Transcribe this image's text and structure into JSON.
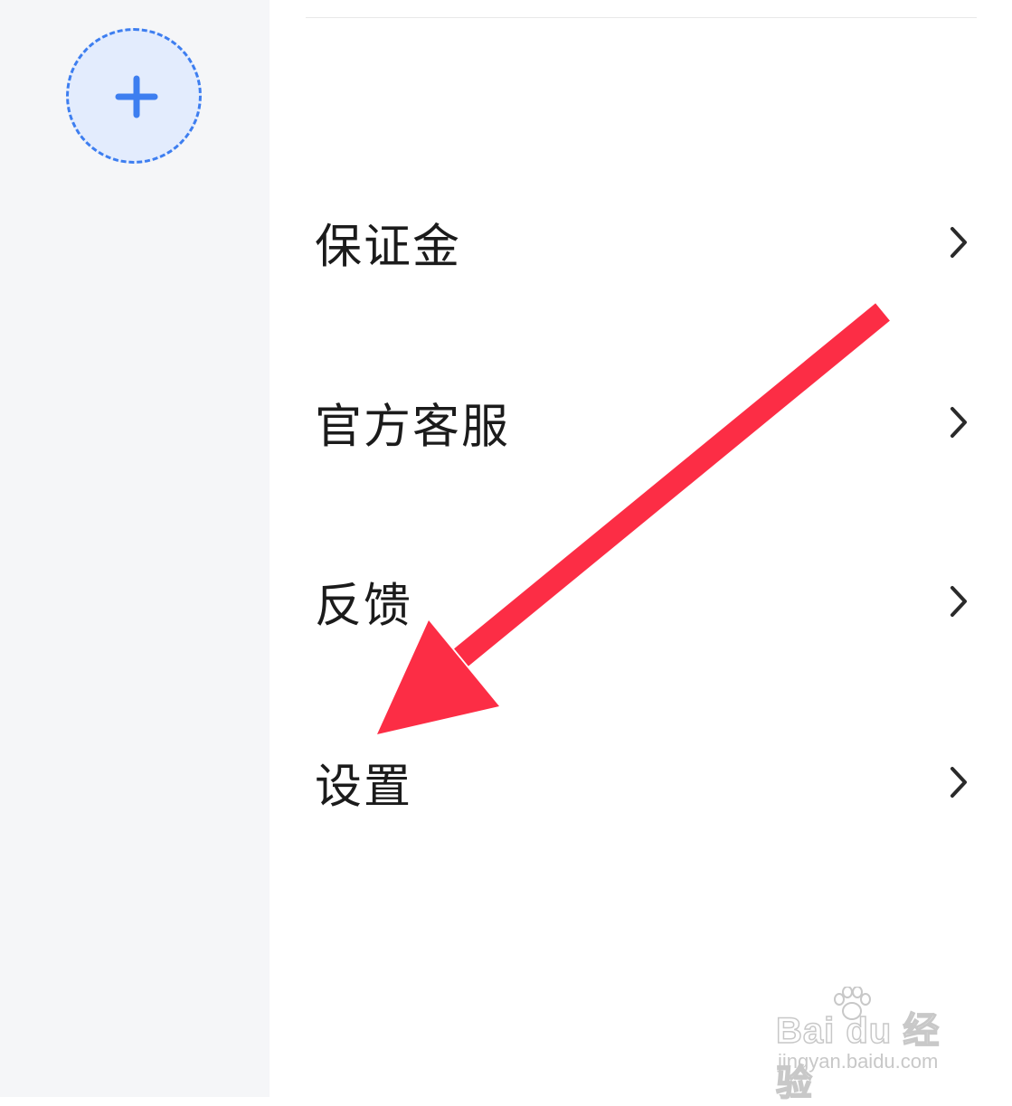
{
  "sidebar": {
    "add_button": {
      "icon": "plus-icon",
      "accent": "#3d7ef0",
      "fill": "#e3ecfd"
    }
  },
  "menu": {
    "items": [
      {
        "label": "保证金",
        "icon": "chevron-right-icon"
      },
      {
        "label": "官方客服",
        "icon": "chevron-right-icon"
      },
      {
        "label": "反馈",
        "icon": "chevron-right-icon"
      },
      {
        "label": "设置",
        "icon": "chevron-right-icon"
      }
    ]
  },
  "annotation": {
    "icon": "red-arrow",
    "color": "#fc2d45",
    "points_to": "设置"
  },
  "watermark": {
    "brand": "Bai du 经验",
    "url": "jingyan.baidu.com"
  }
}
